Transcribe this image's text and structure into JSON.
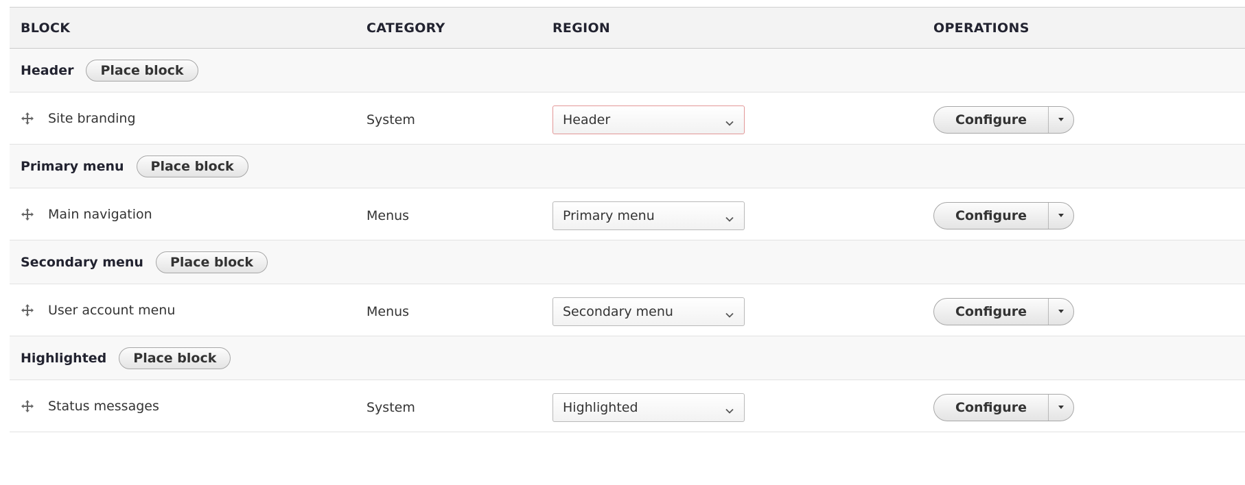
{
  "table": {
    "headers": {
      "block": "BLOCK",
      "category": "CATEGORY",
      "region": "REGION",
      "operations": "OPERATIONS"
    },
    "regions": [
      {
        "title": "Header",
        "place_block_label": "Place block",
        "blocks": [
          {
            "label": "Site branding",
            "category": "System",
            "region_value": "Header",
            "configure_label": "Configure",
            "highlighted_error": true
          }
        ]
      },
      {
        "title": "Primary menu",
        "place_block_label": "Place block",
        "blocks": [
          {
            "label": "Main navigation",
            "category": "Menus",
            "region_value": "Primary menu",
            "configure_label": "Configure",
            "highlighted_error": false
          }
        ]
      },
      {
        "title": "Secondary menu",
        "place_block_label": "Place block",
        "blocks": [
          {
            "label": "User account menu",
            "category": "Menus",
            "region_value": "Secondary menu",
            "configure_label": "Configure",
            "highlighted_error": false
          }
        ]
      },
      {
        "title": "Highlighted",
        "place_block_label": "Place block",
        "blocks": [
          {
            "label": "Status messages",
            "category": "System",
            "region_value": "Highlighted",
            "configure_label": "Configure",
            "highlighted_error": false
          }
        ]
      }
    ]
  },
  "icons": {
    "drag": "move-arrows-icon",
    "select": "chevron-down-icon",
    "dropbutton": "caret-down-icon"
  },
  "colors": {
    "error_border": "#e29696",
    "header_bg": "#f3f3f3",
    "region_row_bg": "#f8f8f8"
  }
}
